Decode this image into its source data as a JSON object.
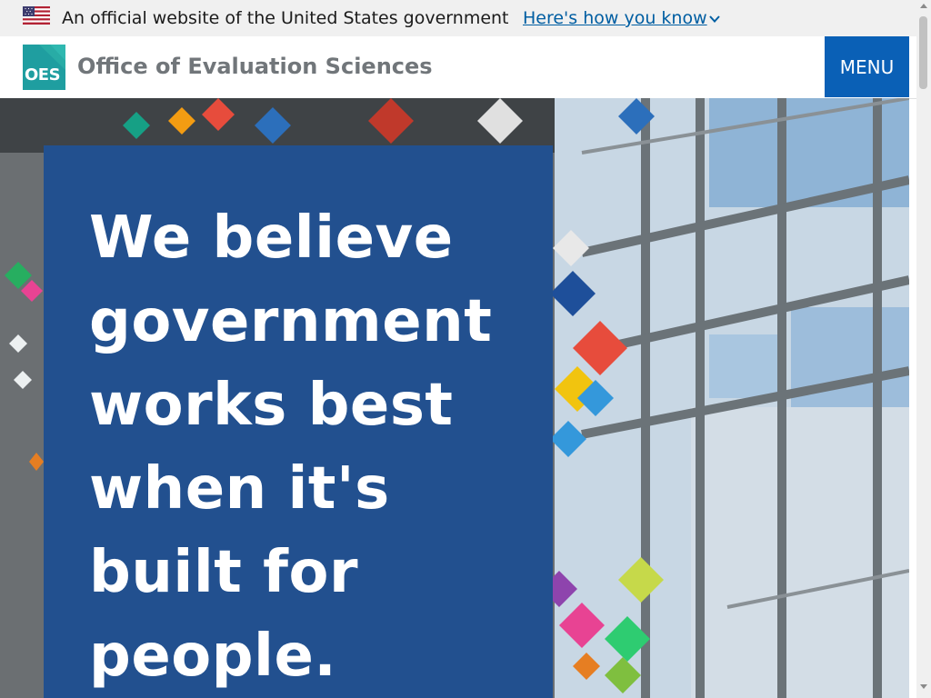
{
  "gov_banner": {
    "text": "An official website of the United States government",
    "link_label": "Here's how you know",
    "link_color": "#005ea2"
  },
  "header": {
    "logo_text": "OES",
    "logo_color": "#1f9ea0",
    "site_title": "Office of Evaluation Sciences",
    "menu_label": "MENU",
    "menu_color": "#0a60b6"
  },
  "hero": {
    "heading": "We believe government works best when it's built for people.",
    "card_color": "#22508f"
  },
  "icons": {
    "flag": "us-flag-icon",
    "chevron": "chevron-down-icon"
  }
}
